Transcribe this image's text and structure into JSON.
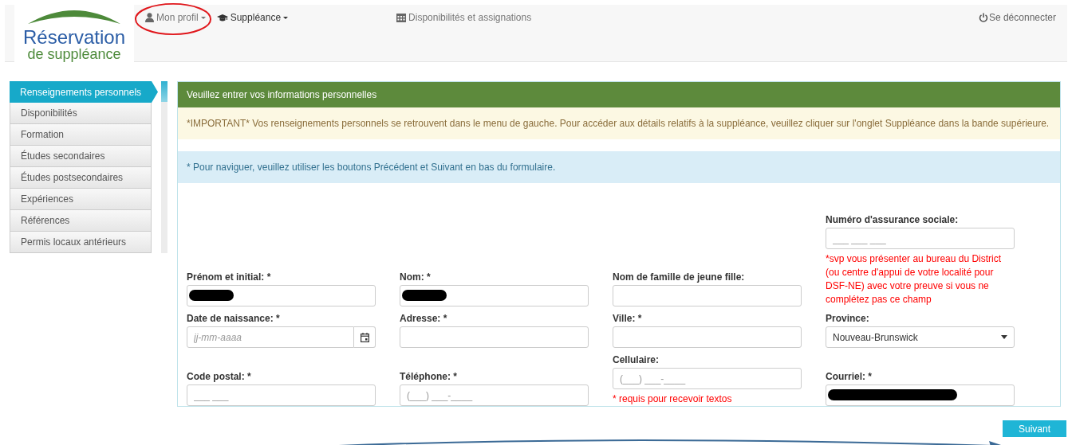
{
  "logo": {
    "title": "Réservation",
    "subtitle": "de suppléance"
  },
  "nav": [
    {
      "label": "Mon profil",
      "dropdown": true,
      "circled": true,
      "bold": false
    },
    {
      "label": "Suppléance",
      "dropdown": true,
      "circled": false,
      "bold": true
    },
    {
      "label": "Disponibilités et assignations",
      "dropdown": false,
      "circled": false,
      "bold": false
    }
  ],
  "logout": {
    "label": "Se déconnecter"
  },
  "sidebar": {
    "items": [
      {
        "label": "Renseignements personnels",
        "selected": true
      },
      {
        "label": "Disponibilités",
        "selected": false
      },
      {
        "label": "Formation",
        "selected": false
      },
      {
        "label": "Études secondaires",
        "selected": false
      },
      {
        "label": "Études postsecondaires",
        "selected": false
      },
      {
        "label": "Expériences",
        "selected": false
      },
      {
        "label": "Références",
        "selected": false
      },
      {
        "label": "Permis locaux antérieurs",
        "selected": false
      }
    ]
  },
  "panel": {
    "title": "Veuillez entrer vos informations personnelles",
    "warning": "*IMPORTANT* Vos renseignements personnels se retrouvent dans le menu de gauche. Pour accéder aux détails relatifs à la suppléance, veuillez cliquer sur l'onglet Suppléance dans la bande supérieure.",
    "info": "* Pour naviguer, veuillez utiliser les boutons Précédent et Suivant en bas du formulaire.",
    "rows": [
      [
        [
          {
            "label": "Prénom et initial: *",
            "kind": "text",
            "redacted": true
          }
        ],
        [
          {
            "label": "Nom: *",
            "kind": "text",
            "redacted": true
          }
        ],
        [
          {
            "label": "Nom de famille de jeune fille:",
            "kind": "text",
            "redacted": false
          }
        ],
        [
          {
            "label": "Numéro d'assurance sociale:",
            "kind": "text",
            "redacted": false,
            "placeholder": "___ ___ ___",
            "note": "*svp vous présenter au bureau du District (ou centre d'appui de votre localité pour DSF-NE) avec votre preuve si vous ne complétez pas ce champ"
          }
        ]
      ],
      [
        [
          {
            "label": "Date de naissance: *",
            "kind": "date",
            "placeholder": "jj-mm-aaaa"
          }
        ],
        [
          {
            "label": "Adresse: *",
            "kind": "text",
            "redacted": false
          }
        ],
        [
          {
            "label": "Ville: *",
            "kind": "text",
            "redacted": false
          }
        ],
        [
          {
            "label": "Province:",
            "kind": "select",
            "value": "Nouveau-Brunswick"
          }
        ]
      ],
      [
        [
          {
            "label": "Code postal: *",
            "kind": "text",
            "redacted": false,
            "placeholder": "___ ___"
          }
        ],
        [
          {
            "label": "Téléphone: *",
            "kind": "text",
            "redacted": false,
            "placeholder": "(___) ___-____"
          }
        ],
        [
          {
            "label": "Cellulaire:",
            "kind": "text",
            "redacted": false,
            "placeholder": "(___) ___-____",
            "note": "* requis pour recevoir textos"
          }
        ],
        [
          {
            "label": "Courriel: *",
            "kind": "text",
            "redacted": true,
            "wide_redaction": true
          }
        ]
      ]
    ]
  },
  "next_button": {
    "label": "Suivant"
  }
}
